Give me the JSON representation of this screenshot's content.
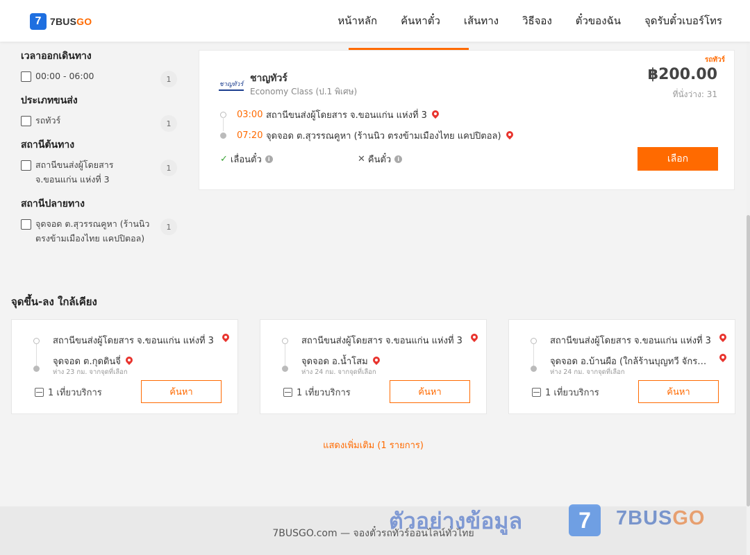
{
  "header": {
    "logo_digit": "7",
    "logo_text_a": "7BUS",
    "logo_text_b": "GO",
    "nav": [
      "หน้าหลัก",
      "ค้นหาตั๋ว",
      "เส้นทาง",
      "วิธีจอง",
      "ตั๋วของฉัน",
      "จุดรับตั๋วเบอร์โทร"
    ]
  },
  "filters": {
    "departure_time": {
      "title": "เวลาออกเดินทาง",
      "options": [
        {
          "label": "00:00 - 06:00",
          "count": "1"
        }
      ]
    },
    "transport_type": {
      "title": "ประเภทขนส่ง",
      "options": [
        {
          "label": "รถทัวร์",
          "count": "1"
        }
      ]
    },
    "origin": {
      "title": "สถานีต้นทาง",
      "options": [
        {
          "label": "สถานีขนส่งผู้โดยสาร จ.ขอนแก่น แห่งที่ 3",
          "count": "1"
        }
      ]
    },
    "destination": {
      "title": "สถานีปลายทาง",
      "options": [
        {
          "label": "จุดจอด ต.สุวรรณคูหา (ร้านนิว ตรงข้ามเมืองไทย แคปปิตอล)",
          "count": "1"
        }
      ]
    }
  },
  "trip": {
    "tag": "รถทัวร์",
    "operator_logo_text": "ชาญทัวร์",
    "operator": "ชาญทัวร์",
    "class": "Economy Class (ป.1 พิเศษ)",
    "price": "฿200.00",
    "seats": "ที่นั่งว่าง: 31",
    "depart_time": "03:00",
    "depart_station": "สถานีขนส่งผู้โดยสาร จ.ขอนแก่น แห่งที่ 3",
    "arrive_time": "07:20",
    "arrive_station": "จุดจอด ต.สุวรรณคูหา (ร้านนิว ตรงข้ามเมืองไทย แคปปิตอล)",
    "reschedule": "เลื่อนตั๋ว",
    "refund": "คืนตั๋ว",
    "select_label": "เลือก"
  },
  "nearby": {
    "title": "จุดขึ้น-ลง ใกล้เคียง",
    "cards": [
      {
        "from": "สถานีขนส่งผู้โดยสาร จ.ขอนแก่น แห่งที่ 3",
        "to": "จุดจอด ต.กุดดินจี่",
        "dist": "ห่าง 23 กม. จากจุดที่เลือก",
        "trips": "1 เที่ยวบริการ",
        "button": "ค้นหา"
      },
      {
        "from": "สถานีขนส่งผู้โดยสาร จ.ขอนแก่น แห่งที่ 3",
        "to": "จุดจอด อ.น้ำโสม",
        "dist": "ห่าง 24 กม. จากจุดที่เลือก",
        "trips": "1 เที่ยวบริการ",
        "button": "ค้นหา"
      },
      {
        "from": "สถานีขนส่งผู้โดยสาร จ.ขอนแก่น แห่งที่ 3",
        "to": "จุดจอด อ.บ้านผือ (ใกล้ร้านบุญทวี จักรยาน)",
        "dist": "ห่าง 24 กม. จากจุดที่เลือก",
        "trips": "1 เที่ยวบริการ",
        "button": "ค้นหา"
      }
    ],
    "show_more": "แสดงเพิ่มเติม (1 รายการ)"
  },
  "footer": {
    "text": "7BUSGO.com — จองตั๋วรถทัวร์ออนไลน์ทั่วไทย",
    "watermark": "ตัวอย่างข้อมูล",
    "wm_digit": "7",
    "wm_brand_a": "7BUS",
    "wm_brand_b": "GO"
  },
  "colors": {
    "accent": "#ff6a00",
    "brand_blue": "#1e6fe0",
    "pin": "#e8342e"
  }
}
